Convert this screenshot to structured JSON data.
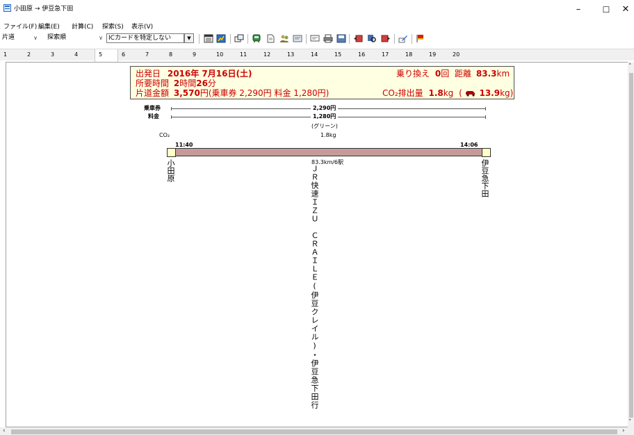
{
  "window": {
    "title": "小田原 → 伊豆急下田",
    "min_glyph": "–",
    "max_glyph": "☐",
    "close_glyph": "✕"
  },
  "menu": [
    "ファイル(F)",
    "編集(E)",
    "計算(C)",
    "探索(S)",
    "表示(V)"
  ],
  "toolbar": {
    "direction": "片道",
    "sort": "探索順",
    "ic_card": "ICカードを特定しない",
    "combo_arrow": "∨",
    "drop_arrow": "▼"
  },
  "tabs": [
    "1",
    "2",
    "3",
    "4",
    "5",
    "6",
    "7",
    "8",
    "9",
    "10",
    "11",
    "12",
    "13",
    "14",
    "15",
    "16",
    "17",
    "18",
    "19",
    "20"
  ],
  "active_tab_index": 4,
  "summary": {
    "depart_label": "出発日",
    "depart_value": "2016年 7月16日(土)",
    "duration_label": "所要時間",
    "duration_h": "2",
    "duration_h_unit": "時間",
    "duration_m": "26",
    "duration_m_unit": "分",
    "fare_label": "片道金額",
    "fare_total": "3,570",
    "fare_detail": "円(乗車券 2,290円 料金 1,280円)",
    "transfer_label": "乗り換え",
    "transfer_value": "0",
    "transfer_unit": "回",
    "distance_label": "距離",
    "distance_value": "83.3",
    "distance_unit": "km",
    "co2_label": "CO₂排出量",
    "co2_value": "1.8",
    "co2_unit": "kg",
    "car_open": "(",
    "car_value": "13.9",
    "car_unit": "kg)"
  },
  "fares": {
    "ticket_label": "乗車券",
    "ticket_value": "2,290円",
    "surcharge_label": "料金",
    "surcharge_value": "1,280円",
    "surcharge_note": "(グリーン)"
  },
  "co2": {
    "label": "CO₂",
    "value": "1.8kg"
  },
  "route": {
    "depart_time": "11:40",
    "arrive_time": "14:06",
    "from_station": "小田原",
    "to_station": "伊豆急下田",
    "distance_stops": "83.3km/6駅",
    "train_name": "ＪＲ快速ＩＺＵ　ＣＲＡＩＬＥ(伊豆クレイル)・伊豆急下田行"
  },
  "colors": {
    "accent_red": "#cc0000",
    "summary_bg": "#ffffe1",
    "route_bar": "#c79a9a",
    "station_box": "#ffffc8"
  }
}
